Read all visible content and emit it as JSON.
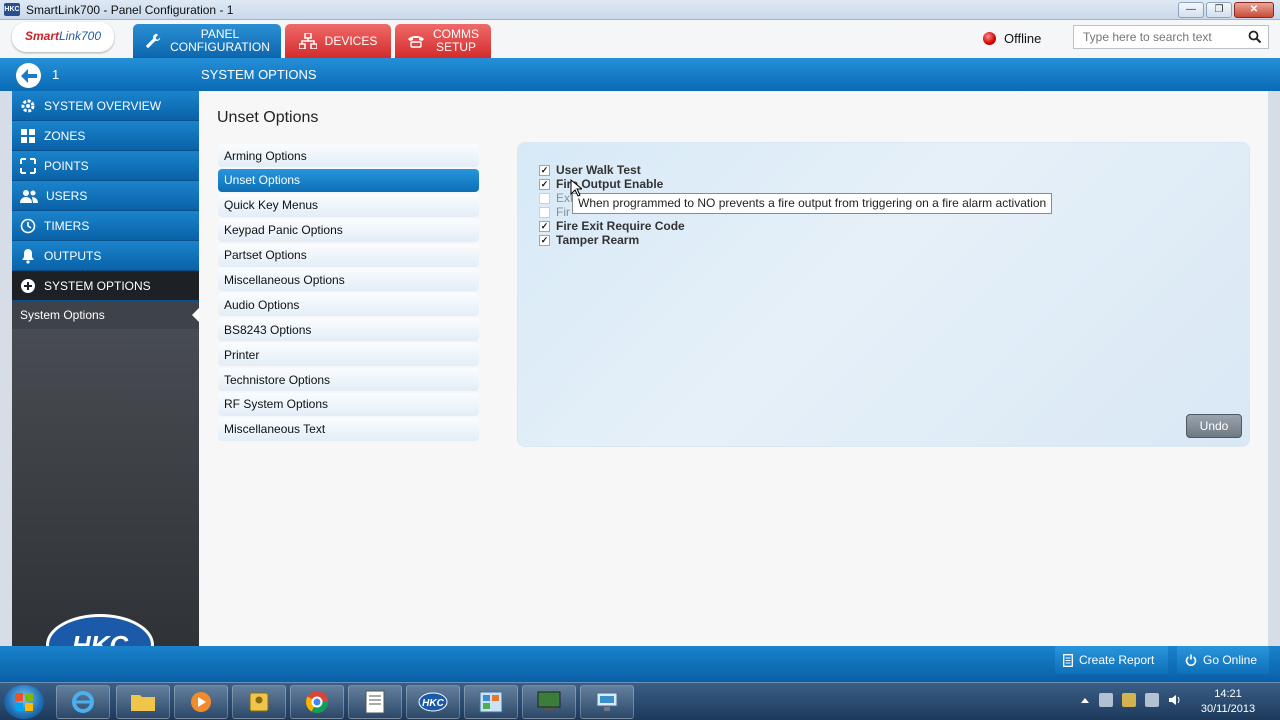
{
  "window": {
    "title": "SmartLink700 - Panel Configuration - 1",
    "app_icon": "hkc-icon"
  },
  "header": {
    "logo": {
      "brand_a": "Smart",
      "brand_b": "Link700"
    },
    "tabs": [
      {
        "line1": "PANEL",
        "line2": "CONFIGURATION",
        "icon": "wrench-icon",
        "color": "#0c66ad"
      },
      {
        "line1": "DEVICES",
        "line2": "",
        "icon": "devices-icon",
        "color": "#d42b2b"
      },
      {
        "line1": "COMMS",
        "line2": "SETUP",
        "icon": "phone-icon",
        "color": "#d42b2b"
      }
    ],
    "status": "Offline",
    "status_color": "#d00000",
    "search_placeholder": "Type here to search text"
  },
  "navbar": {
    "number": "1",
    "title": "SYSTEM OPTIONS"
  },
  "sidebar": {
    "items": [
      {
        "label": "SYSTEM OVERVIEW",
        "icon": "gear-icon"
      },
      {
        "label": "ZONES",
        "icon": "zones-icon"
      },
      {
        "label": "POINTS",
        "icon": "points-icon"
      },
      {
        "label": "USERS",
        "icon": "users-icon"
      },
      {
        "label": "TIMERS",
        "icon": "clock-icon"
      },
      {
        "label": "OUTPUTS",
        "icon": "bell-icon"
      },
      {
        "label": "SYSTEM OPTIONS",
        "icon": "plus-circle-icon"
      }
    ],
    "sub_item": "System Options",
    "brand": "HKC"
  },
  "main": {
    "title": "Unset Options",
    "menu": [
      "Arming Options",
      "Unset Options",
      "Quick Key Menus",
      "Keypad Panic Options",
      "Partset Options",
      "Miscellaneous Options",
      "Audio Options",
      "BS8243 Options",
      "Printer",
      "Technistore Options",
      "RF System Options",
      "Miscellaneous Text"
    ],
    "selected_menu": "Unset Options",
    "options": [
      {
        "label": "User Walk Test",
        "checked": true
      },
      {
        "label": "Fire Output Enable",
        "checked": true
      },
      {
        "label": "Ext",
        "checked": false
      },
      {
        "label": "Fir",
        "checked": false
      },
      {
        "label": "Fire Exit Require Code",
        "checked": true
      },
      {
        "label": "Tamper Rearm",
        "checked": true
      }
    ],
    "tooltip": "When programmed to NO prevents a fire output from triggering on a fire alarm activation",
    "undo_label": "Undo"
  },
  "footer": {
    "create_report": "Create Report",
    "go_online": "Go Online"
  },
  "taskbar": {
    "time": "14:21",
    "date": "30/11/2013"
  }
}
